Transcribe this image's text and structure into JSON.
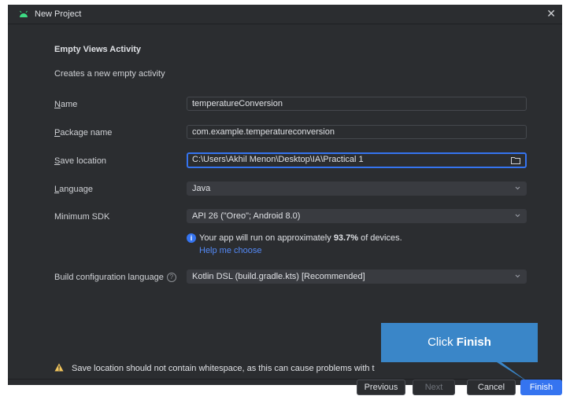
{
  "window": {
    "title": "New Project",
    "close_glyph": "✕"
  },
  "template": {
    "heading": "Empty Views Activity",
    "description": "Creates a new empty activity"
  },
  "form": {
    "name": {
      "label_key": "N",
      "label_rest": "ame",
      "value": "temperatureConversion"
    },
    "package": {
      "label_key": "P",
      "label_rest": "ackage name",
      "value": "com.example.temperatureconversion"
    },
    "save_location": {
      "label_key": "S",
      "label_rest": "ave location",
      "value": "C:\\Users\\Akhil Menon\\Desktop\\IA\\Practical 1"
    },
    "language": {
      "label_key": "L",
      "label_rest": "anguage",
      "value": "Java"
    },
    "min_sdk": {
      "label": "Minimum SDK",
      "value": "API 26 (\"Oreo\"; Android 8.0)"
    },
    "build_config": {
      "label": "Build configuration language",
      "value": "Kotlin DSL (build.gradle.kts) [Recommended]"
    }
  },
  "info": {
    "text_before": "Your app will run on approximately ",
    "percent": "93.7%",
    "text_after": " of devices.",
    "help_link": "Help me choose"
  },
  "warning": {
    "text": "Save location should not contain whitespace, as this can cause problems with t"
  },
  "buttons": {
    "previous": "Previous",
    "next": "Next",
    "cancel": "Cancel",
    "finish": "Finish"
  },
  "callout": {
    "prefix": "Click ",
    "bold": "Finish"
  },
  "colors": {
    "dialog_bg": "#2b2d30",
    "accent": "#3574f0",
    "link": "#548af7",
    "callout": "#3a86c8",
    "warning": "#f2c55c",
    "android_green": "#3ddc84"
  },
  "icons": {
    "android": "android-icon",
    "folder": "folder-icon",
    "chevron": "chevron-down-icon",
    "info": "info-icon",
    "help": "question-icon",
    "warning": "warning-icon"
  }
}
